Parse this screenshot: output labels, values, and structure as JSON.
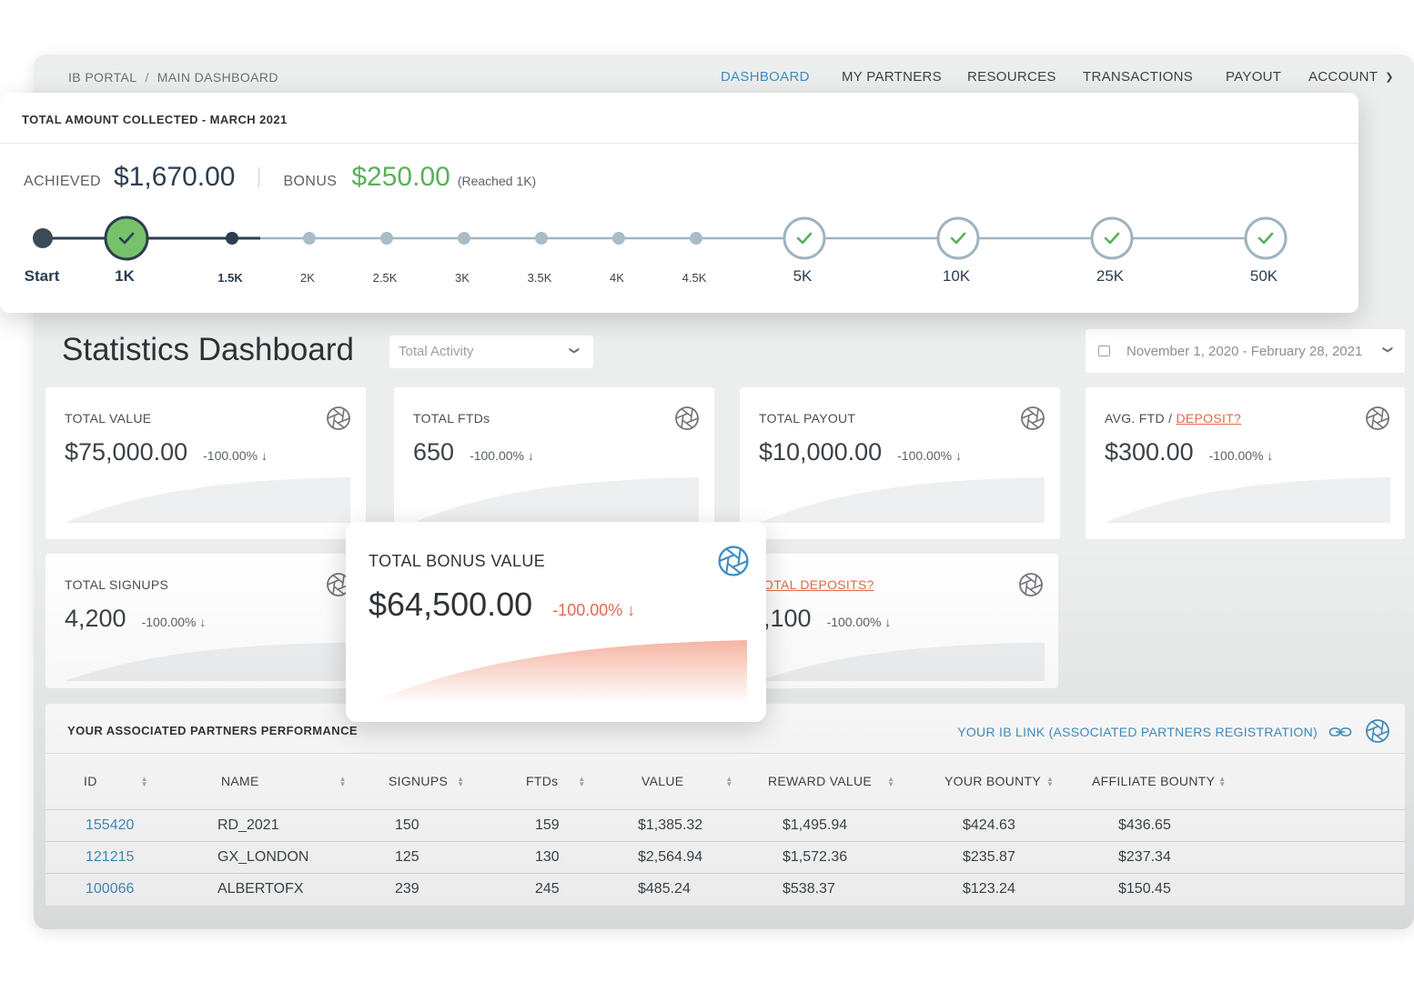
{
  "breadcrumb": {
    "root": "IB PORTAL",
    "separator": "/",
    "current": "MAIN DASHBOARD"
  },
  "nav": [
    {
      "label": "DASHBOARD",
      "active": true
    },
    {
      "label": "MY PARTNERS",
      "active": false
    },
    {
      "label": "RESOURCES",
      "active": false
    },
    {
      "label": "TRANSACTIONS",
      "active": false
    },
    {
      "label": "PAYOUT",
      "active": false
    },
    {
      "label": "ACCOUNT",
      "active": false
    }
  ],
  "progress": {
    "title": "TOTAL AMOUNT COLLECTED - MARCH 2021",
    "achieved_label": "ACHIEVED",
    "achieved_value": "$1,670.00",
    "bonus_label": "BONUS",
    "bonus_value": "$250.00",
    "bonus_note": "(Reached 1K)",
    "steps": [
      {
        "label": "Start",
        "kind": "start"
      },
      {
        "label": "1K",
        "kind": "current"
      },
      {
        "label": "1.5K",
        "kind": "passed"
      },
      {
        "label": "2K",
        "kind": "small"
      },
      {
        "label": "2.5K",
        "kind": "small"
      },
      {
        "label": "3K",
        "kind": "small"
      },
      {
        "label": "3.5K",
        "kind": "small"
      },
      {
        "label": "4K",
        "kind": "small"
      },
      {
        "label": "4.5K",
        "kind": "small"
      },
      {
        "label": "5K",
        "kind": "milestone"
      },
      {
        "label": "10K",
        "kind": "milestone"
      },
      {
        "label": "25K",
        "kind": "milestone"
      },
      {
        "label": "50K",
        "kind": "milestone"
      }
    ]
  },
  "stats": {
    "title": "Statistics Dashboard",
    "activity_select": "Total Activity",
    "date_range": "November 1, 2020 - February 28, 2021"
  },
  "cards": {
    "total_value": {
      "title": "TOTAL VALUE",
      "value": "$75,000.00",
      "change": "-100.00%"
    },
    "total_ftds": {
      "title": "TOTAL FTDs",
      "value": "650",
      "change": "-100.00%"
    },
    "total_payout": {
      "title": "TOTAL PAYOUT",
      "value": "$10,000.00",
      "change": "-100.00%"
    },
    "avg_ftd": {
      "title": "AVG. FTD / ",
      "title_link": "DEPOSIT?",
      "value": "$300.00",
      "change": "-100.00%"
    },
    "total_signups": {
      "title": "TOTAL SIGNUPS",
      "value": "4,200",
      "change": "-100.00%"
    },
    "total_deposits": {
      "title": "OTAL DEPOSITS?",
      "value": ",100",
      "change": "-100.00%"
    },
    "total_bonus": {
      "title": "TOTAL BONUS VALUE",
      "value": "$64,500.00",
      "change": "-100.00%"
    }
  },
  "partners": {
    "title": "YOUR ASSOCIATED PARTNERS PERFORMANCE",
    "ib_link": "YOUR IB LINK (ASSOCIATED PARTNERS REGISTRATION)",
    "columns": [
      "ID",
      "NAME",
      "SIGNUPS",
      "FTDs",
      "VALUE",
      "REWARD VALUE",
      "YOUR BOUNTY",
      "AFFILIATE BOUNTY"
    ],
    "rows": [
      {
        "id": "155420",
        "name": "RD_2021",
        "signups": "150",
        "ftds": "159",
        "value": "$1,385.32",
        "reward": "$1,495.94",
        "your_bounty": "$424.63",
        "affiliate_bounty": "$436.65"
      },
      {
        "id": "121215",
        "name": "GX_LONDON",
        "signups": "125",
        "ftds": "130",
        "value": "$2,564.94",
        "reward": "$1,572.36",
        "your_bounty": "$235.87",
        "affiliate_bounty": "$237.34"
      },
      {
        "id": "100066",
        "name": "ALBERTOFX",
        "signups": "239",
        "ftds": "245",
        "value": "$485.24",
        "reward": "$538.37",
        "your_bounty": "$123.24",
        "affiliate_bounty": "$150.45"
      }
    ]
  },
  "colors": {
    "accent": "#3f8ec1",
    "success": "#5ab05a",
    "danger": "#e3694c",
    "track": "#9fb3c0",
    "track_dark": "#2c3e50"
  },
  "icons": {
    "aperture": "aperture-icon",
    "check": "check-icon",
    "link": "link-icon",
    "calendar": "calendar-icon",
    "chevron": "chevron-down-icon",
    "arrow_down": "arrow-down-icon",
    "sort": "sort-icon"
  }
}
